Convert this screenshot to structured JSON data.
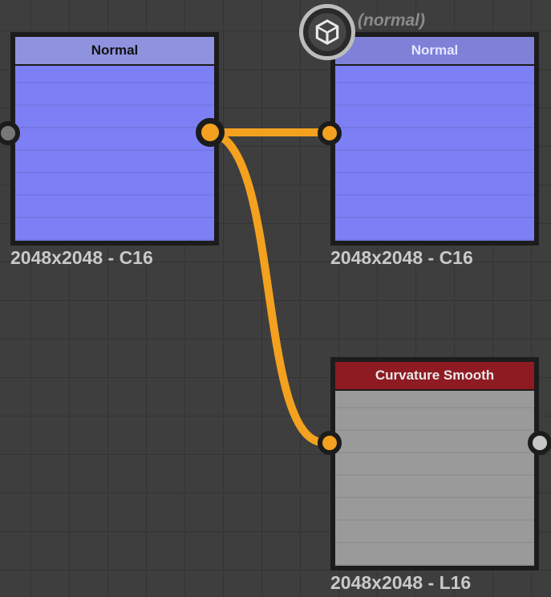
{
  "annotation": "(normal)",
  "nodes": {
    "n1": {
      "title": "Normal",
      "caption": "2048x2048 - C16"
    },
    "n2": {
      "title": "Normal",
      "caption": "2048x2048 - C16"
    },
    "n3": {
      "title": "Curvature Smooth",
      "caption": "2048x2048 - L16"
    }
  },
  "colors": {
    "connection": "#f3a11e",
    "header_blue": "#8f92df",
    "header_red": "#8f1b22"
  }
}
